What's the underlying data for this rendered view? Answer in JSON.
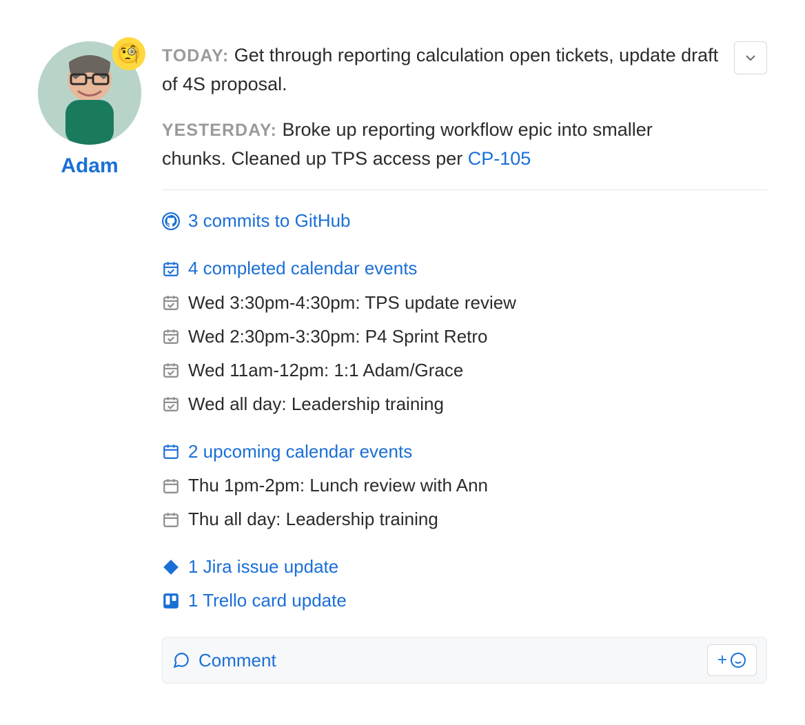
{
  "user": {
    "name": "Adam",
    "status_emoji": "🧐"
  },
  "updates": {
    "today": {
      "label": "TODAY:",
      "text": "Get through reporting calculation open tickets, update draft of 4S proposal."
    },
    "yesterday": {
      "label": "YESTERDAY:",
      "text": "Broke up reporting workflow epic into smaller chunks. Cleaned up TPS access per ",
      "ticket": "CP-105"
    }
  },
  "activity": {
    "github": "3 commits to GitHub",
    "completed_events": {
      "heading": "4 completed calendar events",
      "items": [
        "Wed 3:30pm-4:30pm: TPS update review",
        "Wed 2:30pm-3:30pm: P4 Sprint Retro",
        "Wed 11am-12pm: 1:1 Adam/Grace",
        "Wed all day: Leadership training"
      ]
    },
    "upcoming_events": {
      "heading": "2 upcoming calendar events",
      "items": [
        "Thu 1pm-2pm: Lunch review with Ann",
        "Thu all day: Leadership training"
      ]
    },
    "jira": "1 Jira issue update",
    "trello": "1 Trello card update"
  },
  "comment": {
    "label": "Comment",
    "reaction_plus": "+"
  }
}
